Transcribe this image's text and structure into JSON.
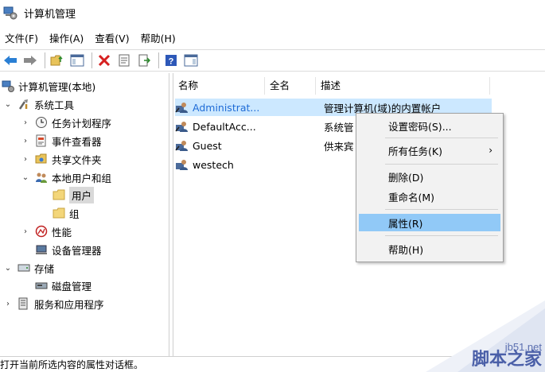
{
  "window": {
    "title": "计算机管理"
  },
  "menubar": [
    "文件(F)",
    "操作(A)",
    "查看(V)",
    "帮助(H)"
  ],
  "tree": {
    "root": "计算机管理(本地)",
    "system_tools": "系统工具",
    "task_scheduler": "任务计划程序",
    "event_viewer": "事件查看器",
    "shared_folders": "共享文件夹",
    "local_users_groups": "本地用户和组",
    "users": "用户",
    "groups": "组",
    "performance": "性能",
    "device_manager": "设备管理器",
    "storage": "存储",
    "disk_management": "磁盘管理",
    "services_apps": "服务和应用程序"
  },
  "list": {
    "columns": [
      "名称",
      "全名",
      "描述"
    ],
    "rows": [
      {
        "name": "Administrat...",
        "fullname": "",
        "desc": "管理计算机(域)的内置帐户"
      },
      {
        "name": "DefaultAcc...",
        "fullname": "",
        "desc": "系统管"
      },
      {
        "name": "Guest",
        "fullname": "",
        "desc": "供来宾"
      },
      {
        "name": "westech",
        "fullname": "",
        "desc": ""
      }
    ]
  },
  "context_menu": {
    "set_password": "设置密码(S)...",
    "all_tasks": "所有任务(K)",
    "delete": "删除(D)",
    "rename": "重命名(M)",
    "properties": "属性(R)",
    "help": "帮助(H)"
  },
  "statusbar": {
    "text": "打开当前所选内容的属性对话框。"
  },
  "watermark": {
    "site": "jb51.net",
    "name": "脚本之家"
  },
  "colors": {
    "selection": "#cce8ff",
    "menu_highlight": "#91c9f7",
    "toolbar_arrow": "#2a7fd4"
  }
}
